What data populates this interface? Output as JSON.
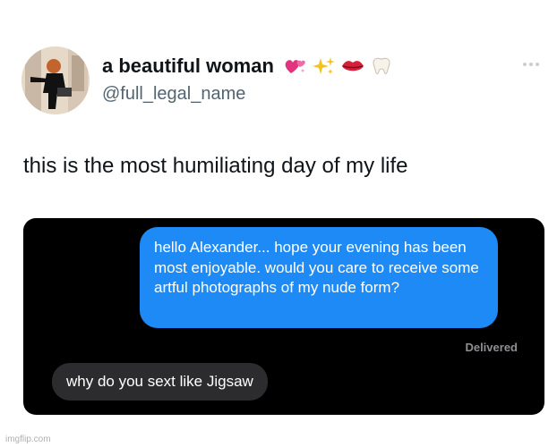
{
  "tweet": {
    "display_name": "a beautiful woman",
    "name_emojis": [
      "hearts-icon",
      "sparkles-icon",
      "lips-icon",
      "tooth-icon"
    ],
    "handle": "@full_legal_name",
    "text": "this is the most humiliating day of my life"
  },
  "screenshot": {
    "outgoing_message": "hello Alexander... hope your evening has been most enjoyable. would you care to receive some artful photographs of my nude form?",
    "delivered_label": "Delivered",
    "incoming_message": "why do you sext like Jigsaw"
  },
  "watermark": "imgflip.com",
  "colors": {
    "outgoing_bubble": "#1e8af5",
    "incoming_bubble": "#2c2c2e",
    "chat_background": "#000000",
    "handle_gray": "#536471"
  }
}
